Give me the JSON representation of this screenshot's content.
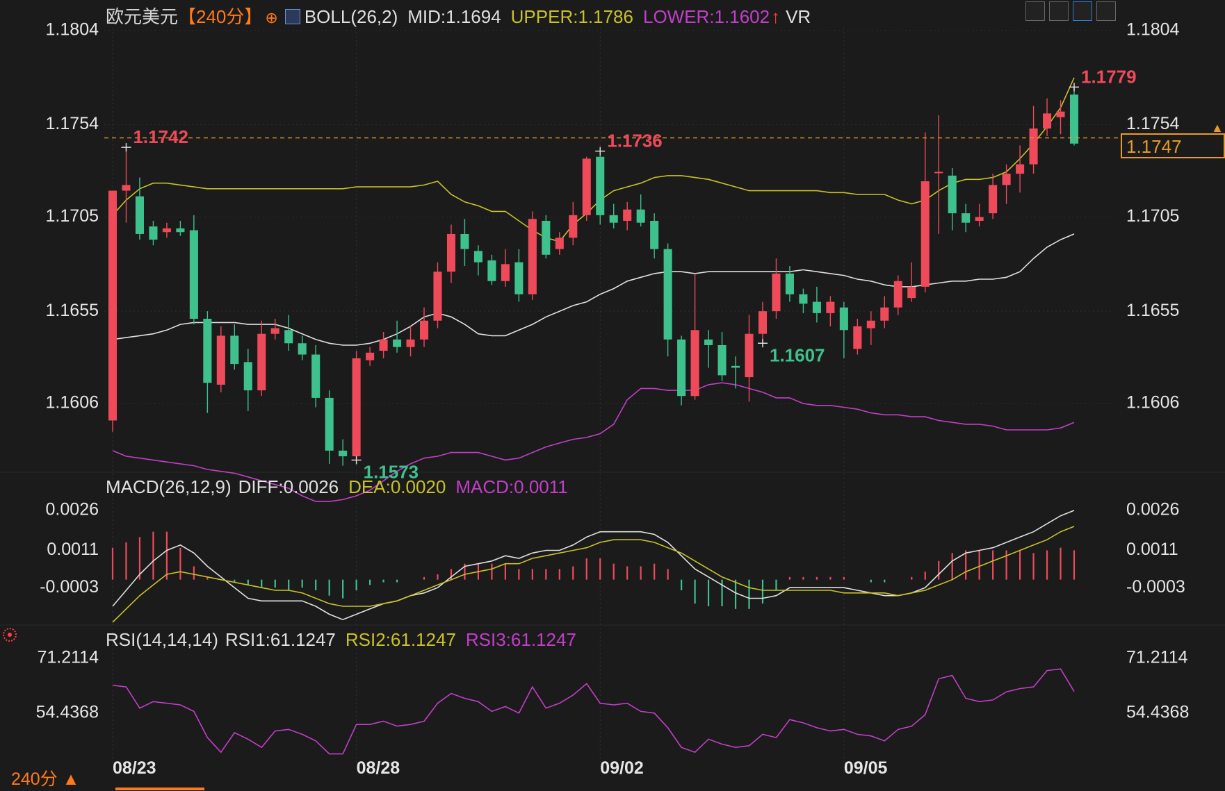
{
  "instrument": "欧元美元",
  "period_label": "【240分】",
  "period_footer": "240分 ▲",
  "boll_header": {
    "name": "BOLL(26,2)",
    "mid": "MID:1.1694",
    "upper": "UPPER:1.1786",
    "lower": "LOWER:1.1602",
    "vr": "VR"
  },
  "macd_header": {
    "name": "MACD(26,12,9)",
    "diff": "DIFF:0.0026",
    "dea": "DEA:0.0020",
    "macd": "MACD:0.0011"
  },
  "rsi_header": {
    "name": "RSI(14,14,14)",
    "rsi1": "RSI1:61.1247",
    "rsi2": "RSI2:61.1247",
    "rsi3": "RSI3:61.1247"
  },
  "colors": {
    "up": "#ef4a5a",
    "down": "#3ec18c",
    "upper": "#c9c12a",
    "mid": "#e0e0e0",
    "lower": "#c23fc8",
    "dea": "#c9c12a",
    "rsi": "#c23fc8",
    "price_line": "#e89a2a",
    "period": "#ff7a1a"
  },
  "current_price": "1.1747",
  "annotations": [
    {
      "label": "1.1742",
      "kind": "high",
      "idx": 1
    },
    {
      "label": "1.1736",
      "kind": "high",
      "idx": 36
    },
    {
      "label": "1.1779",
      "kind": "high",
      "idx": 71
    },
    {
      "label": "1.1573",
      "kind": "low",
      "idx": 18
    },
    {
      "label": "1.1607",
      "kind": "low",
      "idx": 48
    }
  ],
  "chart_data": [
    {
      "type": "candlestick",
      "title": "欧元美元 240分",
      "y_ticks": [
        "1.1804",
        "1.1754",
        "1.1705",
        "1.1655",
        "1.1606"
      ],
      "ylim": [
        1.1571,
        1.1804
      ],
      "x_ticks": [
        {
          "label": "08/23",
          "idx": 0
        },
        {
          "label": "08/28",
          "idx": 18
        },
        {
          "label": "09/02",
          "idx": 36
        },
        {
          "label": "09/05",
          "idx": 54
        }
      ],
      "candles": [
        [
          1.1597,
          1.1719,
          1.1591,
          1.1719
        ],
        [
          1.1719,
          1.1722,
          1.1742,
          1.1702
        ],
        [
          1.1716,
          1.1696,
          1.1726,
          1.1693
        ],
        [
          1.17,
          1.1693,
          1.1703,
          1.169
        ],
        [
          1.1697,
          1.1699,
          1.1702,
          1.1694
        ],
        [
          1.1699,
          1.1697,
          1.1703,
          1.1695
        ],
        [
          1.1698,
          1.1651,
          1.1706,
          1.1648
        ],
        [
          1.1651,
          1.1617,
          1.1655,
          1.1601
        ],
        [
          1.1616,
          1.1642,
          1.1647,
          1.1612
        ],
        [
          1.1642,
          1.1627,
          1.1648,
          1.1624
        ],
        [
          1.1628,
          1.1613,
          1.1635,
          1.1602
        ],
        [
          1.1613,
          1.1643,
          1.165,
          1.161
        ],
        [
          1.1643,
          1.1646,
          1.1651,
          1.164
        ],
        [
          1.1645,
          1.1638,
          1.1653,
          1.1634
        ],
        [
          1.1638,
          1.1632,
          1.1642,
          1.1629
        ],
        [
          1.1632,
          1.1609,
          1.1637,
          1.1604
        ],
        [
          1.1609,
          1.1581,
          1.1613,
          1.1574
        ],
        [
          1.1581,
          1.1578,
          1.1587,
          1.1573
        ],
        [
          1.1578,
          1.163,
          1.1634,
          1.1576
        ],
        [
          1.1629,
          1.1633,
          1.1636,
          1.1626
        ],
        [
          1.1634,
          1.164,
          1.1644,
          1.163
        ],
        [
          1.164,
          1.1636,
          1.165,
          1.1633
        ],
        [
          1.1636,
          1.164,
          1.1647,
          1.1631
        ],
        [
          1.164,
          1.165,
          1.1657,
          1.1636
        ],
        [
          1.165,
          1.1676,
          1.1681,
          1.1646
        ],
        [
          1.1676,
          1.1696,
          1.1701,
          1.167
        ],
        [
          1.1696,
          1.1688,
          1.1704,
          1.1679
        ],
        [
          1.1687,
          1.1681,
          1.169,
          1.1674
        ],
        [
          1.1682,
          1.1671,
          1.1685,
          1.1669
        ],
        [
          1.1671,
          1.168,
          1.1688,
          1.1668
        ],
        [
          1.1681,
          1.1664,
          1.1688,
          1.166
        ],
        [
          1.1664,
          1.1704,
          1.1708,
          1.1661
        ],
        [
          1.1703,
          1.1685,
          1.1706,
          1.1683
        ],
        [
          1.1688,
          1.1694,
          1.1697,
          1.1685
        ],
        [
          1.1694,
          1.1706,
          1.1713,
          1.169
        ],
        [
          1.1706,
          1.1736,
          1.1737,
          1.1703
        ],
        [
          1.1737,
          1.1706,
          1.174,
          1.1701
        ],
        [
          1.1706,
          1.1702,
          1.1712,
          1.1699
        ],
        [
          1.1703,
          1.1709,
          1.1713,
          1.1698
        ],
        [
          1.1709,
          1.1702,
          1.1717,
          1.17
        ],
        [
          1.1703,
          1.1688,
          1.1707,
          1.1683
        ],
        [
          1.1688,
          1.164,
          1.1691,
          1.1631
        ],
        [
          1.164,
          1.161,
          1.1642,
          1.1605
        ],
        [
          1.161,
          1.1645,
          1.1675,
          1.1608
        ],
        [
          1.164,
          1.1637,
          1.1645,
          1.1625
        ],
        [
          1.1637,
          1.1621,
          1.1644,
          1.1618
        ],
        [
          1.1626,
          1.1625,
          1.1631,
          1.1614
        ],
        [
          1.162,
          1.1643,
          1.1653,
          1.1607
        ],
        [
          1.1643,
          1.1655,
          1.166,
          1.1638
        ],
        [
          1.1655,
          1.1675,
          1.1683,
          1.1651
        ],
        [
          1.1675,
          1.1664,
          1.1679,
          1.166
        ],
        [
          1.1664,
          1.1659,
          1.1667,
          1.1654
        ],
        [
          1.166,
          1.1654,
          1.1668,
          1.1649
        ],
        [
          1.1654,
          1.166,
          1.1663,
          1.1647
        ],
        [
          1.1657,
          1.1645,
          1.166,
          1.163
        ],
        [
          1.1635,
          1.1647,
          1.1651,
          1.1632
        ],
        [
          1.1646,
          1.165,
          1.1655,
          1.1637
        ],
        [
          1.165,
          1.1657,
          1.1663,
          1.1646
        ],
        [
          1.1657,
          1.1671,
          1.1674,
          1.1653
        ],
        [
          1.1662,
          1.1668,
          1.1681,
          1.166
        ],
        [
          1.1668,
          1.1724,
          1.175,
          1.1665
        ],
        [
          1.1729,
          1.1729,
          1.1759,
          1.1696
        ],
        [
          1.1727,
          1.1707,
          1.1731,
          1.1698
        ],
        [
          1.1707,
          1.1702,
          1.1712,
          1.1697
        ],
        [
          1.1703,
          1.1705,
          1.1712,
          1.17
        ],
        [
          1.1707,
          1.1722,
          1.1728,
          1.1704
        ],
        [
          1.1722,
          1.1728,
          1.1733,
          1.1712
        ],
        [
          1.1728,
          1.1733,
          1.1743,
          1.1718
        ],
        [
          1.1733,
          1.1752,
          1.1764,
          1.1728
        ],
        [
          1.1752,
          1.176,
          1.1768,
          1.1748
        ],
        [
          1.1758,
          1.1761,
          1.1767,
          1.1749
        ],
        [
          1.177,
          1.1744,
          1.1774,
          1.1743
        ]
      ],
      "series": [
        {
          "name": "UPPER",
          "values": [
            1.1706,
            1.1714,
            1.172,
            1.1723,
            1.1723,
            1.1722,
            1.1721,
            1.172,
            1.172,
            1.172,
            1.172,
            1.172,
            1.172,
            1.172,
            1.172,
            1.172,
            1.172,
            1.172,
            1.1721,
            1.1721,
            1.1721,
            1.1721,
            1.1721,
            1.1722,
            1.1724,
            1.1717,
            1.1713,
            1.1711,
            1.1708,
            1.1708,
            1.1703,
            1.1698,
            1.1694,
            1.1692,
            1.1701,
            1.1707,
            1.1714,
            1.1719,
            1.1721,
            1.1723,
            1.1726,
            1.1727,
            1.1727,
            1.1726,
            1.1725,
            1.1723,
            1.1721,
            1.1719,
            1.1719,
            1.1719,
            1.1719,
            1.1719,
            1.1719,
            1.1718,
            1.1718,
            1.1717,
            1.1717,
            1.1717,
            1.1714,
            1.1712,
            1.1714,
            1.1719,
            1.1723,
            1.1725,
            1.1725,
            1.1726,
            1.1729,
            1.1736,
            1.1744,
            1.1753,
            1.1763,
            1.1779
          ]
        },
        {
          "name": "MID",
          "values": [
            1.164,
            1.1641,
            1.1642,
            1.1643,
            1.1645,
            1.1648,
            1.1649,
            1.1649,
            1.1649,
            1.1649,
            1.1648,
            1.1648,
            1.1648,
            1.1646,
            1.1643,
            1.164,
            1.1638,
            1.1637,
            1.1637,
            1.1638,
            1.164,
            1.1643,
            1.1647,
            1.1652,
            1.1654,
            1.1652,
            1.1648,
            1.1643,
            1.1642,
            1.1642,
            1.1645,
            1.1648,
            1.1652,
            1.1655,
            1.1658,
            1.166,
            1.1664,
            1.1667,
            1.1671,
            1.1673,
            1.1675,
            1.1676,
            1.1676,
            1.1675,
            1.1676,
            1.1676,
            1.1676,
            1.1676,
            1.1676,
            1.1676,
            1.1676,
            1.1677,
            1.1676,
            1.1675,
            1.1674,
            1.1672,
            1.1671,
            1.1669,
            1.1668,
            1.1668,
            1.1669,
            1.167,
            1.1671,
            1.1671,
            1.1672,
            1.1672,
            1.1673,
            1.1676,
            1.1683,
            1.1689,
            1.1693,
            1.1696
          ]
        },
        {
          "name": "LOWER",
          "values": [
            1.1581,
            1.1578,
            1.1577,
            1.1576,
            1.1575,
            1.1574,
            1.1573,
            1.1571,
            1.157,
            1.1569,
            1.1567,
            1.1565,
            1.1563,
            1.1561,
            1.1557,
            1.1554,
            1.1554,
            1.1555,
            1.1557,
            1.156,
            1.1565,
            1.157,
            1.1574,
            1.1577,
            1.1578,
            1.158,
            1.158,
            1.158,
            1.1578,
            1.1576,
            1.1577,
            1.158,
            1.1583,
            1.1585,
            1.1587,
            1.1588,
            1.159,
            1.1595,
            1.1608,
            1.1614,
            1.1614,
            1.1613,
            1.1613,
            1.1613,
            1.1616,
            1.1617,
            1.1616,
            1.1614,
            1.1612,
            1.1609,
            1.1609,
            1.1606,
            1.1605,
            1.1605,
            1.1604,
            1.1603,
            1.1601,
            1.16,
            1.16,
            1.1599,
            1.1599,
            1.1597,
            1.1596,
            1.1595,
            1.1595,
            1.1594,
            1.1592,
            1.1592,
            1.1592,
            1.1592,
            1.1593,
            1.1596
          ]
        }
      ]
    },
    {
      "type": "line+bar",
      "title": "MACD(26,12,9)",
      "y_ticks": [
        "0.0026",
        "0.0011",
        "-0.0003"
      ],
      "ylim": [
        -0.0016,
        0.0032
      ],
      "series": [
        {
          "name": "DIFF",
          "values": [
            -0.001,
            -0.0004,
            0.0002,
            0.0007,
            0.0011,
            0.0013,
            0.001,
            0.0005,
            0.0001,
            -0.0003,
            -0.0007,
            -0.0008,
            -0.0008,
            -0.0008,
            -0.0008,
            -0.001,
            -0.0013,
            -0.0015,
            -0.0013,
            -0.0011,
            -0.0009,
            -0.0008,
            -0.0006,
            -0.0005,
            -0.0003,
            0.0001,
            0.0005,
            0.0006,
            0.0007,
            0.0009,
            0.0008,
            0.001,
            0.0011,
            0.0011,
            0.0013,
            0.0016,
            0.0018,
            0.0018,
            0.0018,
            0.0018,
            0.0017,
            0.0014,
            0.0009,
            0.0004,
            0.0001,
            -0.0002,
            -0.0005,
            -0.0007,
            -0.0007,
            -0.0006,
            -0.0003,
            -0.0003,
            -0.0003,
            -0.0003,
            -0.0003,
            -0.0004,
            -0.0005,
            -0.0006,
            -0.0006,
            -0.0005,
            -0.0003,
            0.0002,
            0.0007,
            0.001,
            0.0011,
            0.0012,
            0.0014,
            0.0016,
            0.0018,
            0.0021,
            0.0024,
            0.0026
          ]
        },
        {
          "name": "DEA",
          "values": [
            -0.0016,
            -0.0011,
            -0.0006,
            -0.0002,
            0.0002,
            0.0003,
            0.0002,
            0.0001,
            0.0,
            -0.0001,
            -0.0002,
            -0.0003,
            -0.0004,
            -0.0004,
            -0.0005,
            -0.0007,
            -0.0009,
            -0.001,
            -0.001,
            -0.001,
            -0.0009,
            -0.0008,
            -0.0006,
            -0.0004,
            -0.0002,
            0.0,
            0.0002,
            0.0003,
            0.0004,
            0.0006,
            0.0006,
            0.0008,
            0.0009,
            0.001,
            0.0011,
            0.0012,
            0.0014,
            0.0015,
            0.0015,
            0.0015,
            0.0014,
            0.0012,
            0.001,
            0.0007,
            0.0004,
            0.0001,
            -0.0001,
            -0.0003,
            -0.0004,
            -0.0004,
            -0.0004,
            -0.0004,
            -0.0004,
            -0.0004,
            -0.0005,
            -0.0005,
            -0.0005,
            -0.0005,
            -0.0006,
            -0.0005,
            -0.0004,
            -0.0002,
            0.0,
            0.0003,
            0.0005,
            0.0007,
            0.0009,
            0.0011,
            0.0013,
            0.0015,
            0.0018,
            0.002
          ]
        },
        {
          "name": "MACD",
          "values": [
            0.0012,
            0.0014,
            0.0016,
            0.0018,
            0.0018,
            0.0012,
            0.0005,
            0.0001,
            0.0,
            -0.0001,
            -0.0002,
            -0.0003,
            -0.0003,
            -0.0004,
            -0.0003,
            -0.0004,
            -0.0006,
            -0.0007,
            -0.0004,
            -0.0002,
            -0.0001,
            -0.0001,
            0.0,
            0.0001,
            0.0002,
            0.0004,
            0.0006,
            0.0006,
            0.0006,
            0.0006,
            0.0004,
            0.0004,
            0.0004,
            0.0004,
            0.0005,
            0.0008,
            0.0008,
            0.0006,
            0.0005,
            0.0005,
            0.0006,
            0.0004,
            -0.0004,
            -0.0009,
            -0.001,
            -0.001,
            -0.0011,
            -0.0011,
            -0.0009,
            -0.0004,
            0.0001,
            0.0001,
            0.0001,
            0.0001,
            0.0001,
            0.0,
            -0.0001,
            -0.0001,
            0.0,
            0.0001,
            0.0003,
            0.0007,
            0.001,
            0.0011,
            0.0011,
            0.0011,
            0.0011,
            0.0011,
            0.001,
            0.0011,
            0.0012,
            0.0011
          ]
        }
      ]
    },
    {
      "type": "line",
      "title": "RSI(14,14,14)",
      "y_ticks": [
        "71.2114",
        "54.4368"
      ],
      "ylim": [
        40.0,
        74.0
      ],
      "series": [
        {
          "name": "RSI",
          "values": [
            63.0,
            62.5,
            56.0,
            58.0,
            57.5,
            57.0,
            55.0,
            47.0,
            42.5,
            48.5,
            46.5,
            44.0,
            49.0,
            49.5,
            48.0,
            46.0,
            42.0,
            42.0,
            51.0,
            51.0,
            52.0,
            50.5,
            51.0,
            52.0,
            57.5,
            60.5,
            59.0,
            58.0,
            55.0,
            56.5,
            54.5,
            62.5,
            56.0,
            57.5,
            60.0,
            63.5,
            57.5,
            57.0,
            57.5,
            55.0,
            54.5,
            50.0,
            44.0,
            42.5,
            46.5,
            45.0,
            44.0,
            44.5,
            48.0,
            47.0,
            52.5,
            51.5,
            50.0,
            49.0,
            49.5,
            48.0,
            47.5,
            46.0,
            49.5,
            50.5,
            54.0,
            65.0,
            66.0,
            59.0,
            58.0,
            58.5,
            61.0,
            62.0,
            62.5,
            67.5,
            68.0,
            61.1
          ]
        }
      ]
    }
  ]
}
